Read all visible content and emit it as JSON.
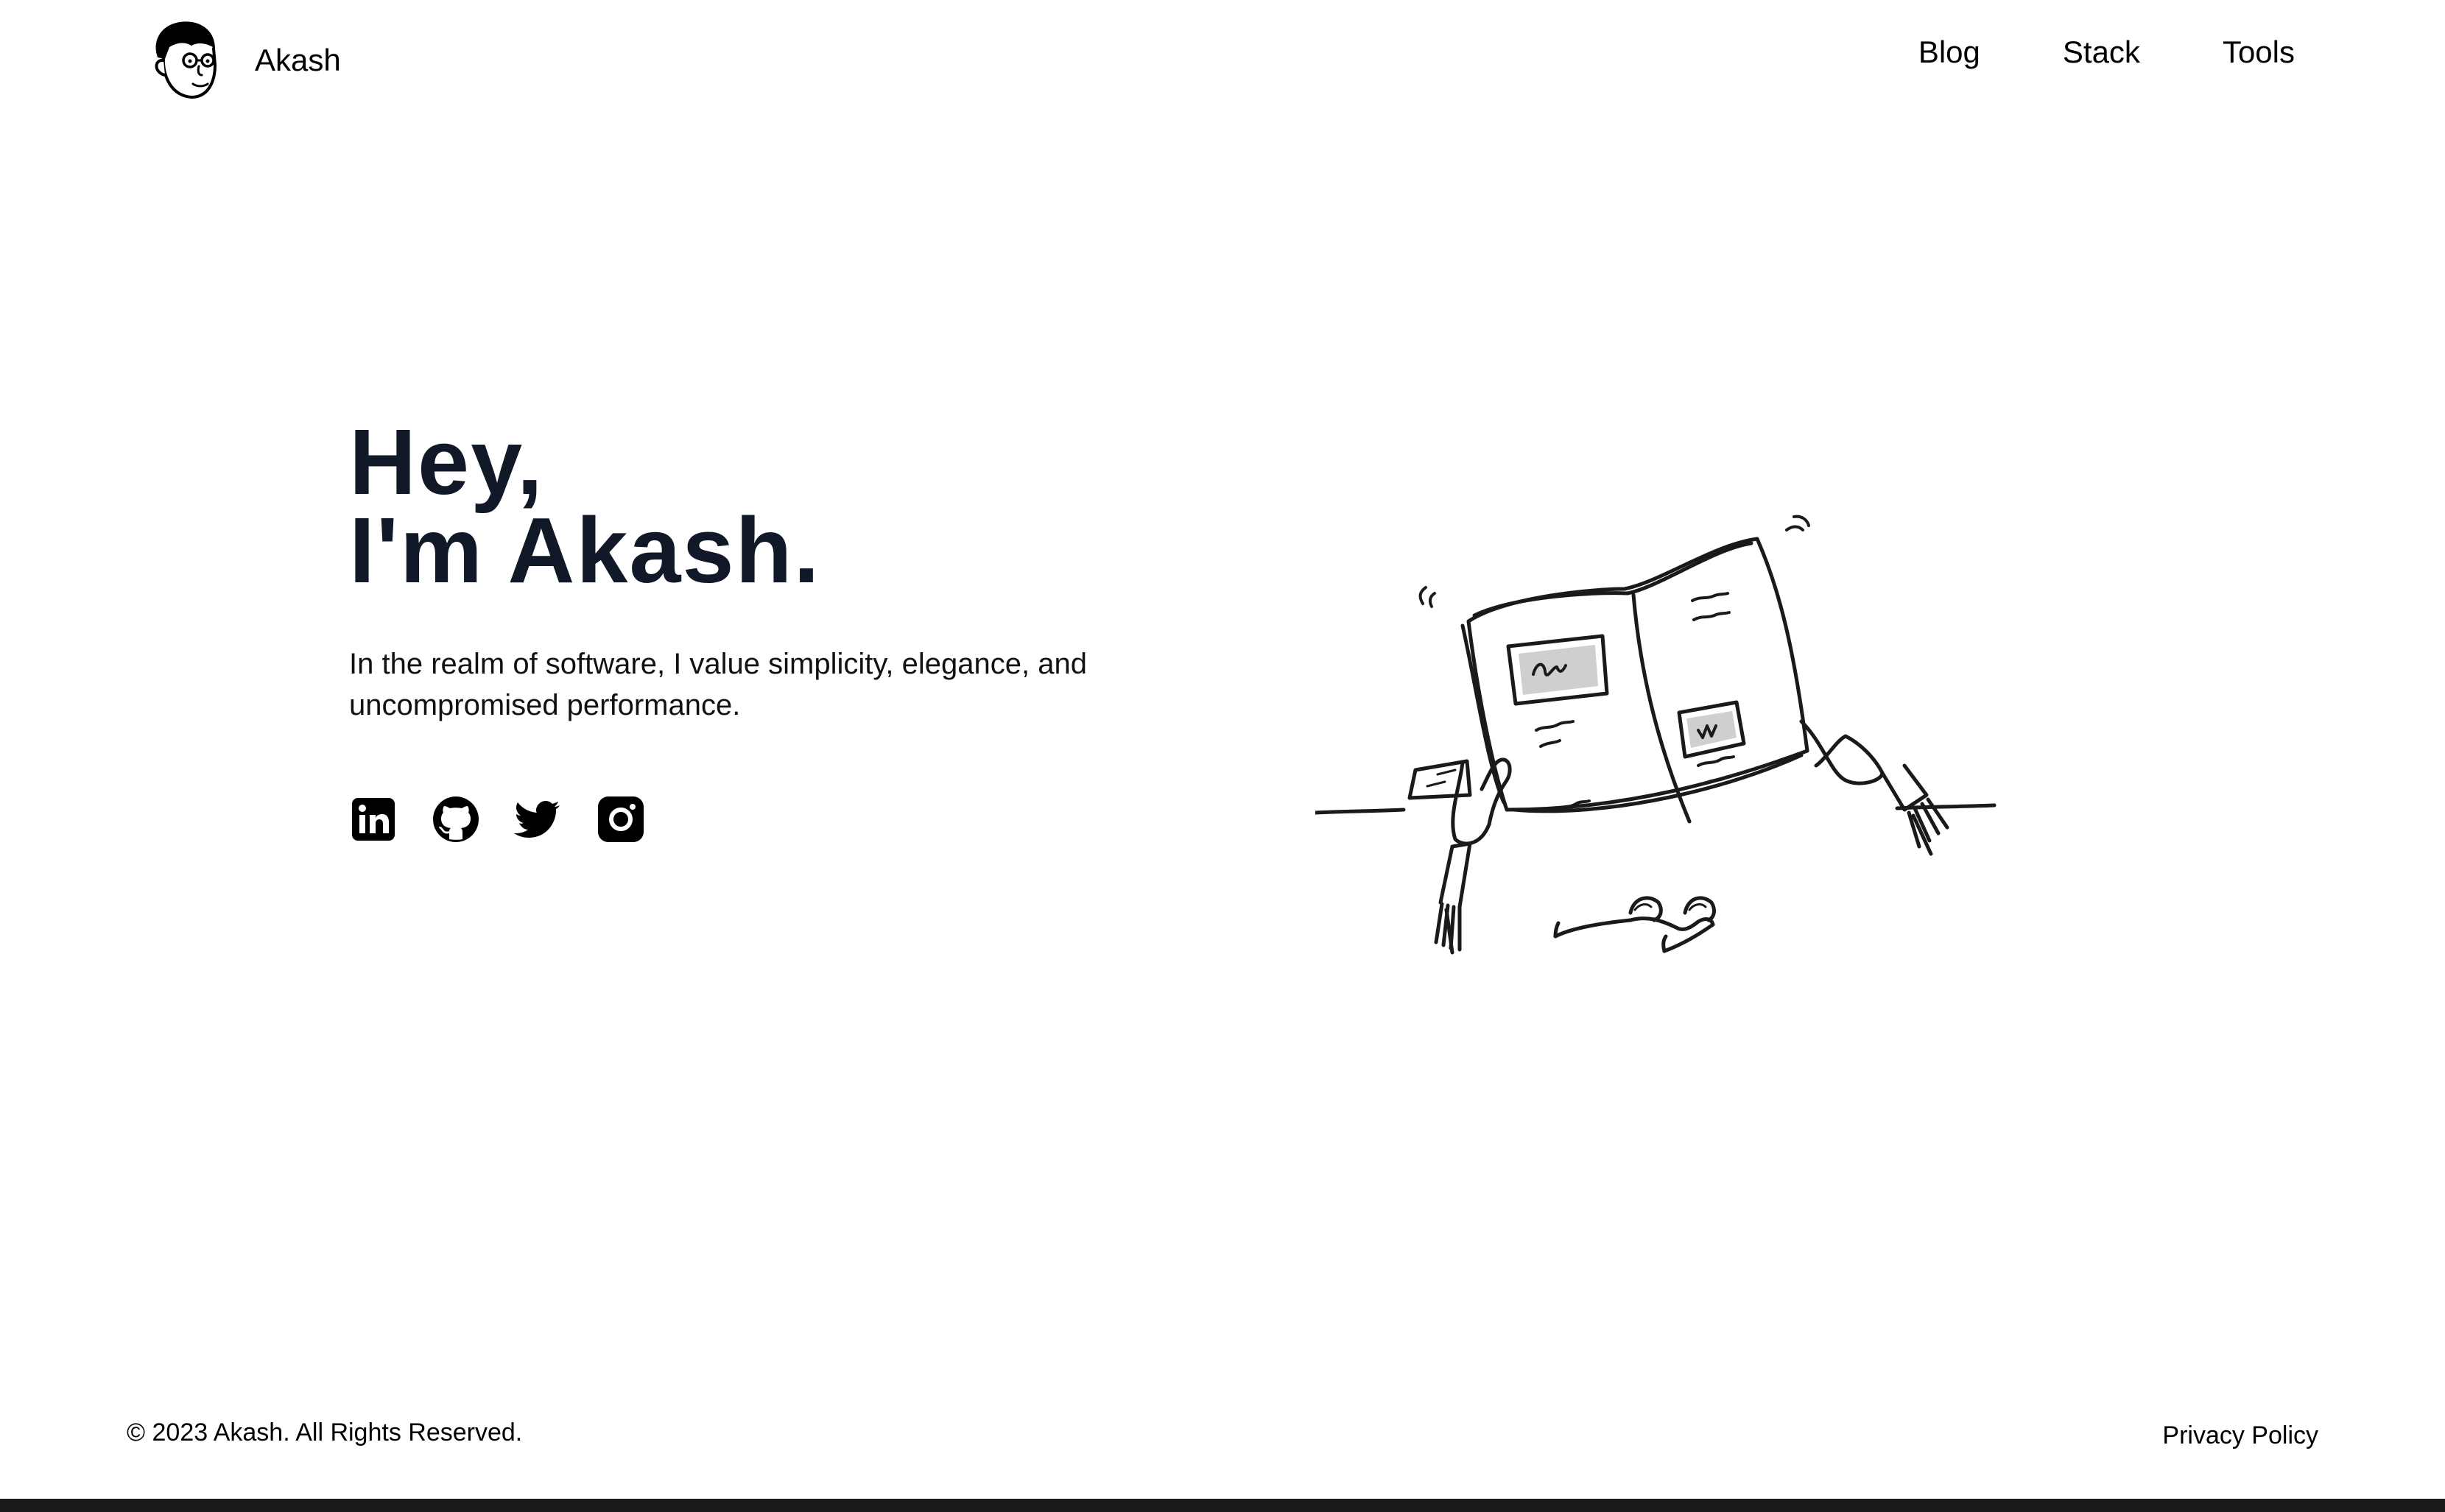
{
  "header": {
    "brand": {
      "name": "Akash",
      "avatar_icon": "cartoon-face-icon"
    },
    "nav": [
      {
        "label": "Blog"
      },
      {
        "label": "Stack"
      },
      {
        "label": "Tools"
      }
    ]
  },
  "hero": {
    "title_line1": "Hey,",
    "title_line2": "I'm Akash.",
    "description": "In the realm of software, I value simplicity, elegance, and uncompromised performance.",
    "socials": [
      {
        "name": "linkedin",
        "icon": "linkedin-icon"
      },
      {
        "name": "github",
        "icon": "github-icon"
      },
      {
        "name": "twitter",
        "icon": "twitter-icon"
      },
      {
        "name": "instagram",
        "icon": "instagram-icon"
      }
    ],
    "illustration": "person-reading-newspaper-illustration"
  },
  "footer": {
    "copyright": "© 2023 Akash. All Rights Reserved.",
    "privacy_label": "Privacy Policy"
  },
  "colors": {
    "background": "#ffffff",
    "heading": "#111827",
    "text": "#000000",
    "bottom_bar": "#1a1a1a"
  }
}
